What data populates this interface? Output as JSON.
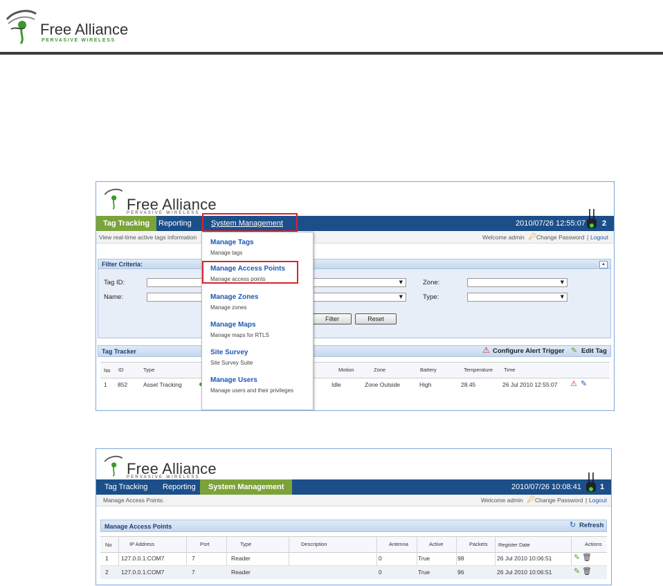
{
  "page": {
    "logo_brand": "Free Alliance",
    "logo_tagline": "PERVASIVE WIRELESS"
  },
  "shot1": {
    "logo_brand": "Free Alliance",
    "logo_tagline": "PERVASIVE WIRELESS",
    "tabs": [
      "Tag Tracking",
      "Reporting",
      "System Management"
    ],
    "clock": "2010/07/26 12:55:07",
    "ap_count": "2",
    "subtitle": "View real-time active tags information",
    "welcome": "Welcome admin",
    "change_password": "Change Password",
    "separator": "|",
    "logout": "Logout",
    "filter_title": "Filter Criteria:",
    "filter_labels": {
      "tag_id": "Tag ID:",
      "name": "Name:",
      "zone": "Zone:",
      "type": "Type:"
    },
    "filter_button": "Filter",
    "reset_button": "Reset",
    "tracker_title": "Tag Tracker",
    "configure_alert": "Configure Alert Trigger",
    "edit_tag": "Edit Tag",
    "columns": [
      "No",
      "ID",
      "Type",
      "Motion",
      "Zone",
      "Battery",
      "Temperature",
      "Time"
    ],
    "row": {
      "no": "1",
      "id": "852",
      "type": "Asset Tracking",
      "motion": "Idle",
      "zone": "Zone Outside",
      "battery": "High",
      "temperature": "28.45",
      "time": "26 Jul 2010 12:55:07"
    },
    "menu": [
      {
        "title": "Manage Tags",
        "desc": "Manage tags"
      },
      {
        "title": "Manage Access Points",
        "desc": "Manage access points"
      },
      {
        "title": "Manage Zones",
        "desc": "Manage zones"
      },
      {
        "title": "Manage Maps",
        "desc": "Manage maps for RTLS"
      },
      {
        "title": "Site Survey",
        "desc": "Site Survey Suite"
      },
      {
        "title": "Manage Users",
        "desc": "Manage users and their privileges"
      }
    ]
  },
  "shot2": {
    "logo_brand": "Free Alliance",
    "logo_tagline": "PERVASIVE WIRELESS",
    "tabs": [
      "Tag Tracking",
      "Reporting",
      "System Management"
    ],
    "clock": "2010/07/26 10:08:41",
    "ap_count": "1",
    "subtitle": "Manage Access Points.",
    "welcome": "Welcome admin",
    "change_password": "Change Password",
    "separator": "|",
    "logout": "Logout",
    "panel_title": "Manage Access Points",
    "refresh": "Refresh",
    "columns": [
      "No",
      "IP Address",
      "Port",
      "Type",
      "Description",
      "Antenna",
      "Active",
      "Packets",
      "Register Date",
      "Actions"
    ],
    "rows": [
      {
        "no": "1",
        "ip": "127.0.0.1:COM7",
        "port": "7",
        "type": "Reader",
        "desc": "",
        "antenna": "0",
        "active": "True",
        "packets": "98",
        "date": "26 Jul 2010 10:06:51"
      },
      {
        "no": "2",
        "ip": "127.0.0.1:COM7",
        "port": "7",
        "type": "Reader",
        "desc": "",
        "antenna": "0",
        "active": "True",
        "packets": "96",
        "date": "26 Jul 2010 10:06:51"
      }
    ]
  },
  "colors": {
    "nav": "#1c4f8a",
    "active_tab": "#7ba33a",
    "highlight": "#d9232a",
    "link": "#1c58b5"
  }
}
